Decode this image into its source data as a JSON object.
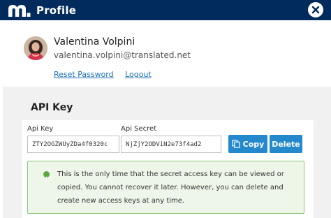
{
  "header": {
    "title": "Profile",
    "logo_icon": "matecat-logo-icon",
    "close_icon": "close-icon",
    "background_color": "#002b5c"
  },
  "user": {
    "name": "Valentina Volpini",
    "email": "valentina.volpini@translated.net",
    "avatar_icon": "user-avatar"
  },
  "links": {
    "reset_password": "Reset Password",
    "logout": "Logout"
  },
  "api": {
    "title": "API Key",
    "key_label": "Api Key",
    "key_value": "ZTY2OGZWUyZDa4f0320c",
    "secret_label": "Api Secret",
    "secret_value": "NjZjY2ODViN2e73f4ad2",
    "copy_label": "Copy",
    "copy_icon": "copy-icon",
    "delete_label": "Delete",
    "button_color": "#2388cc",
    "notice_icon": "info-icon",
    "notice": "This is the only time that the secret access key can be viewed or copied. You cannot recover it later. However, you can delete and create new access keys at any time."
  }
}
